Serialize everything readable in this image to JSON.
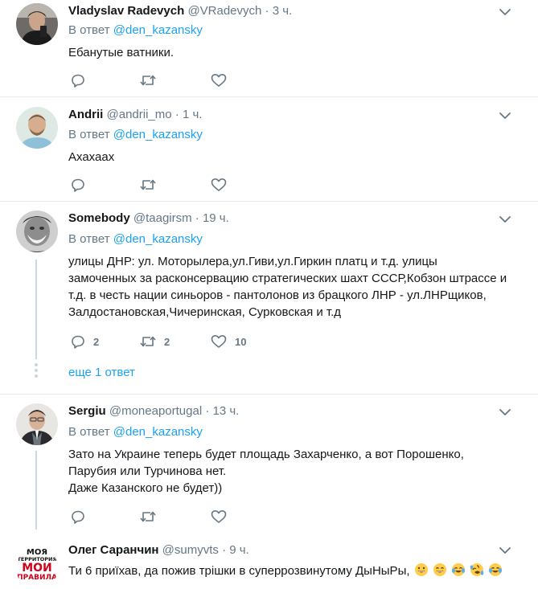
{
  "reply_prefix": "В ответ",
  "tweets": [
    {
      "name": "Vladyslav Radevych",
      "handle": "@VRadevych",
      "time": "3 ч.",
      "reply_to": "@den_kazansky",
      "lines": [
        "Ебанутые ватники."
      ],
      "counts": {
        "reply": "",
        "retweet": "",
        "like": ""
      }
    },
    {
      "name": "Andrii",
      "handle": "@andrii_mo",
      "time": "1 ч.",
      "reply_to": "@den_kazansky",
      "lines": [
        "Ахахаах"
      ],
      "counts": {
        "reply": "",
        "retweet": "",
        "like": ""
      }
    },
    {
      "name": "Somebody",
      "handle": "@taagirsm",
      "time": "19 ч.",
      "reply_to": "@den_kazansky",
      "lines": [
        "улицы ДНР: ул. Моторылера,ул.Гиви,ул.Гиркин платц и т.д. улицы",
        "замоченных за расконсервацию стратегических шахт СССР,Кобзон штрассе и",
        "т.д. в честь нации синьоров - пантолонов из брацкого ЛНР - ул.ЛНРщиков,",
        "Залдостановская,Чичеринская, Сурковская и т.д"
      ],
      "counts": {
        "reply": "2",
        "retweet": "2",
        "like": "10"
      },
      "more_replies": "еще 1 ответ"
    },
    {
      "name": "Sergiu",
      "handle": "@moneaportugal",
      "time": "13 ч.",
      "reply_to": "@den_kazansky",
      "lines": [
        "Зато на Украине теперь будет площадь Захарченко, а вот Порошенко,",
        "Парубия или Турчинова нет.",
        "Даже Казанского не будет))"
      ],
      "counts": {
        "reply": "",
        "retweet": "",
        "like": ""
      }
    },
    {
      "name": "Олег Саранчин",
      "handle": "@sumyvts",
      "time": "9 ч.",
      "lines": [
        "Ти 6 приїхав, да пожив трішки в суперрозвинутому ДыНыРы,"
      ],
      "emoji_names": [
        "grinning-face",
        "grinning-face-smiling-eyes",
        "tears-of-joy",
        "rolling-laughing",
        "tears-of-joy"
      ]
    }
  ],
  "avatar5_text": [
    "МОЯ",
    "ТЕРРИТОРИЯ",
    "МОИ",
    "ПРАВИЛА"
  ],
  "colors": {
    "accent": "#1da1f2",
    "muted": "#657786",
    "text": "#14171a",
    "border": "#e6ecf0",
    "thread": "#ccd6dd"
  }
}
